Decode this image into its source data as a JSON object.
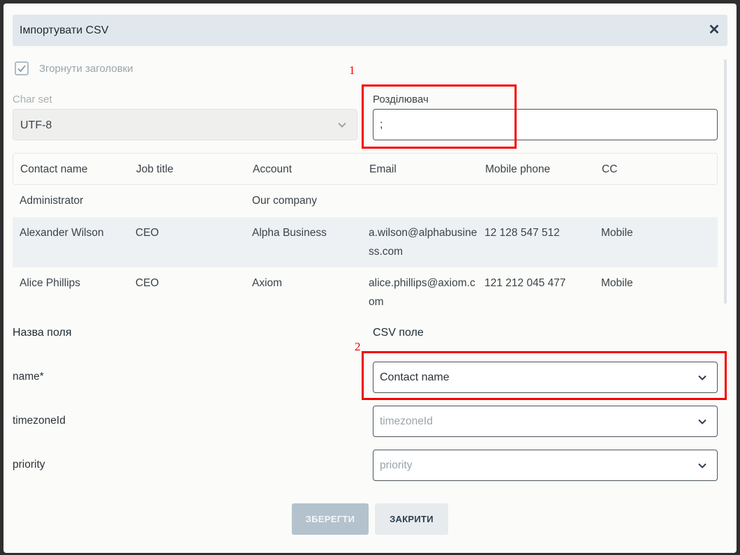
{
  "dialog": {
    "title": "Імпортувати CSV",
    "close_icon": "close-icon"
  },
  "collapse_headers": {
    "label": "Згорнути заголовки",
    "checked": true
  },
  "charset": {
    "label": "Char set",
    "value": "UTF-8"
  },
  "delimiter": {
    "label": "Розділювач",
    "value": ";"
  },
  "preview": {
    "columns": [
      "Contact name",
      "Job title",
      "Account",
      "Email",
      "Mobile phone",
      "CC"
    ],
    "rows": [
      [
        "Administrator",
        "",
        "Our company",
        "",
        "",
        ""
      ],
      [
        "Alexander Wilson",
        "CEO",
        "Alpha Business",
        "a.wilson@alphabusiness.com",
        "12 128 547 512",
        "Mobile"
      ],
      [
        "Alice Phillips",
        "CEO",
        "Axiom",
        "alice.phillips@axiom.com",
        "121 212 045 477",
        "Mobile"
      ]
    ]
  },
  "mapping": {
    "field_header": "Назва поля",
    "csv_header": "CSV поле",
    "rows": [
      {
        "field": "name*",
        "csv_value": "Contact name"
      },
      {
        "field": "timezoneId",
        "csv_value": "timezoneId"
      },
      {
        "field": "priority",
        "csv_value": "priority"
      }
    ]
  },
  "annotations": [
    "1",
    "2"
  ],
  "buttons": {
    "save": "ЗБЕРЕГТИ",
    "close": "ЗАКРИТИ"
  },
  "colors": {
    "annotation": "#f20000",
    "title_bar": "#e1e8ed",
    "save_disabled": "#b3c2cc"
  }
}
